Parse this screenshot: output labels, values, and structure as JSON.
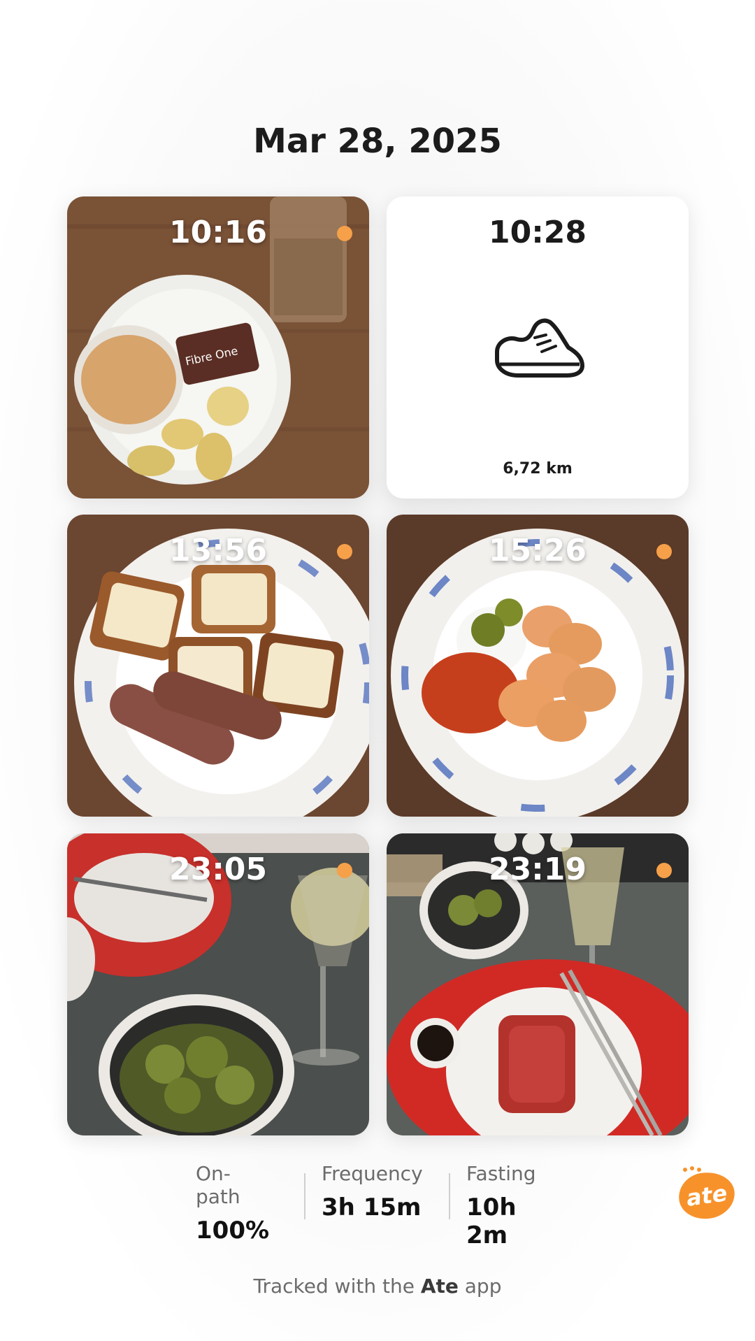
{
  "date": "Mar 28, 2025",
  "tiles": [
    {
      "time": "10:16",
      "kind": "meal",
      "has_dot": true
    },
    {
      "time": "10:28",
      "kind": "activity",
      "icon": "shoe-icon",
      "distance": "6,72 km"
    },
    {
      "time": "13:56",
      "kind": "meal",
      "has_dot": true
    },
    {
      "time": "15:26",
      "kind": "meal",
      "has_dot": true
    },
    {
      "time": "23:05",
      "kind": "meal",
      "has_dot": true
    },
    {
      "time": "23:19",
      "kind": "meal",
      "has_dot": true
    }
  ],
  "stats": [
    {
      "label": "On-path",
      "value": "100%"
    },
    {
      "label": "Frequency",
      "value": "3h 15m"
    },
    {
      "label": "Fasting",
      "value": "10h 2m"
    }
  ],
  "logo": {
    "text": "ate",
    "color": "#f7922b"
  },
  "footer": {
    "prefix": "Tracked with the ",
    "brand": "Ate",
    "suffix": " app"
  },
  "colors": {
    "accent_dot": "#f6a04a"
  }
}
